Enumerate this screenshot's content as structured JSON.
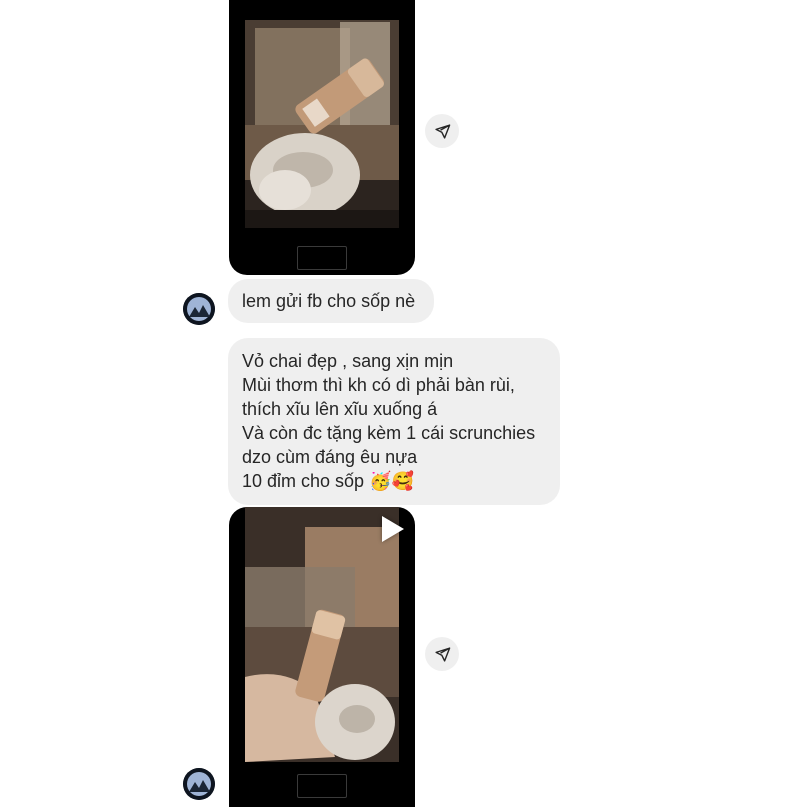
{
  "messages": {
    "short_reply": "lem gửi fb cho sốp nè",
    "review_lines": [
      "Vỏ chai đẹp , sang xịn mịn",
      "Mùi thơm thì kh có dì phải bàn rùi,",
      "thích xĩu lên xĩu xuống á",
      "Và còn đc tặng kèm 1 cái scrunchies",
      "dzo cùm đáng êu nựa",
      "10 đỉm cho sốp 🥳🥰"
    ]
  },
  "icons": {
    "share": "paper-plane-icon",
    "play": "play-icon",
    "avatar": "user-avatar"
  },
  "colors": {
    "bubble": "#efefef",
    "share_button": "#efefef",
    "text": "#262626",
    "media_frame": "#000000"
  }
}
